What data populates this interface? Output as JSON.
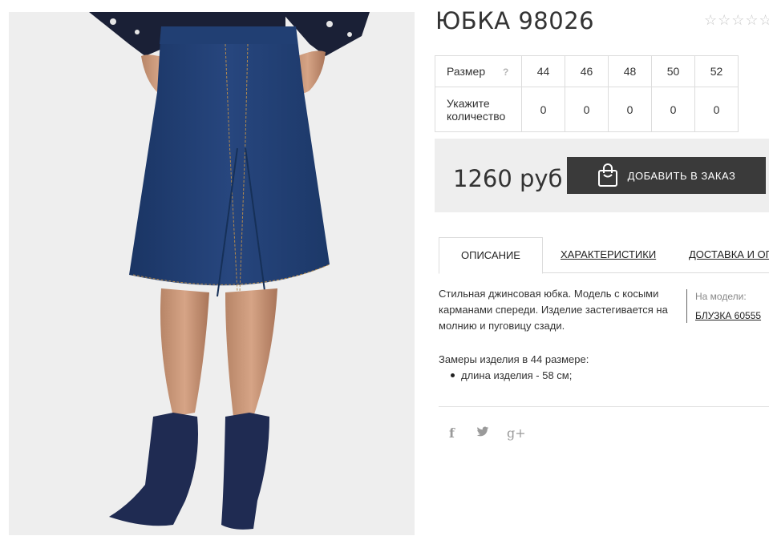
{
  "product": {
    "title": "ЮБКА 98026",
    "rating_stars": "☆☆☆☆☆",
    "rating_value": 0
  },
  "sizes": {
    "size_label": "Размер",
    "help_label": "?",
    "qty_label_line1": "Укажите",
    "qty_label_line2": "количество",
    "items": [
      {
        "size": "44",
        "qty": "0"
      },
      {
        "size": "46",
        "qty": "0"
      },
      {
        "size": "48",
        "qty": "0"
      },
      {
        "size": "50",
        "qty": "0"
      },
      {
        "size": "52",
        "qty": "0"
      }
    ]
  },
  "order": {
    "price": "1260 руб",
    "add_button": "ДОБАВИТЬ В ЗАКАЗ"
  },
  "tabs": [
    {
      "label": "ОПИСАНИЕ",
      "active": true
    },
    {
      "label": "ХАРАКТЕРИСТИКИ",
      "active": false
    },
    {
      "label": "ДОСТАВКА И ОПЛ",
      "active": false
    }
  ],
  "description": {
    "text": "Стильная джинсовая юбка. Модель с косыми карманами спереди. Изделие застегивается на молнию и пуговицу сзади.",
    "on_model_label": "На модели:",
    "on_model_link": "БЛУЗКА 60555",
    "measurements_title": "Замеры изделия в 44 размере:",
    "measurements": [
      "длина изделия - 58 см;"
    ]
  },
  "share": {
    "facebook": "f",
    "twitter": "🐦",
    "google_plus": "g+"
  },
  "icons": {
    "bag": "shopping-bag-icon",
    "facebook": "facebook-icon",
    "twitter": "twitter-icon",
    "google_plus": "google-plus-icon"
  },
  "colors": {
    "button_bg": "#3a3a3a",
    "price_box_bg": "#eeeeee",
    "denim": "#1f3a6b"
  }
}
